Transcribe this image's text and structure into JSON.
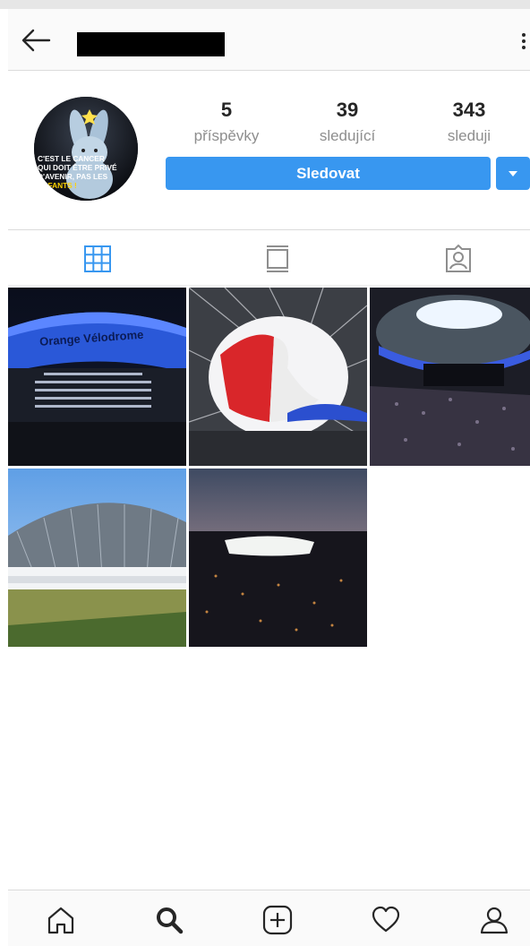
{
  "header": {
    "back_icon": "back-arrow-icon",
    "username_redacted": true,
    "more_icon": "more-vertical-icon"
  },
  "profile": {
    "avatar_lines": [
      "C'EST LE CANCER",
      "QUI DOIT ÊTRE PRIVÉ",
      "D'AVENIR, PAS LES",
      "ENFANTS !"
    ],
    "stats": [
      {
        "value": "5",
        "label": "příspěvky"
      },
      {
        "value": "39",
        "label": "sledující"
      },
      {
        "value": "343",
        "label": "sleduji"
      }
    ],
    "follow_label": "Sledovat",
    "dropdown_icon": "chevron-down-icon"
  },
  "tabs": [
    {
      "name": "grid",
      "icon": "grid-icon",
      "active": true
    },
    {
      "name": "feed",
      "icon": "feed-icon",
      "active": false
    },
    {
      "name": "tagged",
      "icon": "tagged-icon",
      "active": false
    }
  ],
  "posts": [
    {
      "caption": "Orange Vélodrome"
    },
    {
      "caption": ""
    },
    {
      "caption": ""
    },
    {
      "caption": ""
    },
    {
      "caption": ""
    }
  ],
  "bottom_nav": [
    "home-icon",
    "search-icon",
    "add-post-icon",
    "activity-heart-icon",
    "profile-icon"
  ],
  "colors": {
    "accent": "#3897f0",
    "muted": "#8e8e8e",
    "text": "#262626",
    "border": "#dbdbdb"
  }
}
